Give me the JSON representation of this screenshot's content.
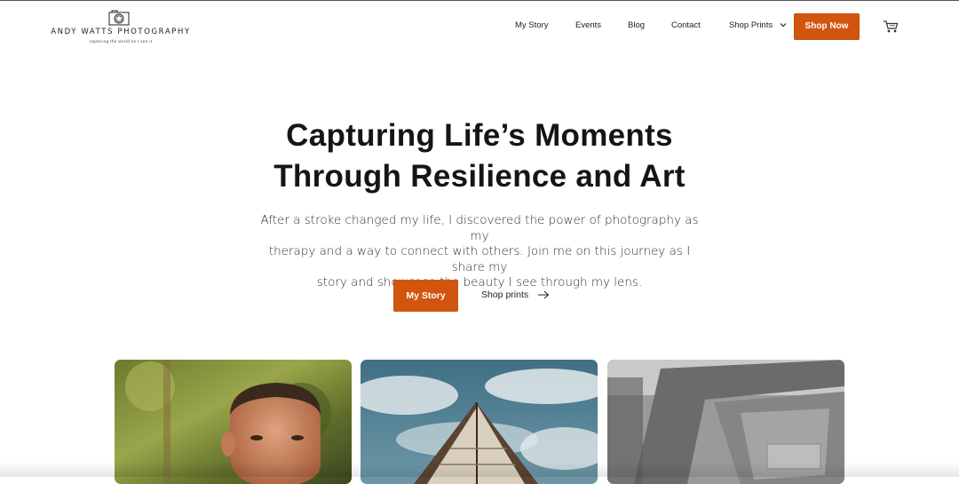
{
  "brand": {
    "name": "ANDY WATTS PHOTOGRAPHY",
    "tagline": "capturing the world as I see it",
    "logo_icon": "camera-icon"
  },
  "nav": {
    "items": [
      {
        "label": "My Story"
      },
      {
        "label": "Events"
      },
      {
        "label": "Blog"
      },
      {
        "label": "Contact"
      },
      {
        "label": "Shop Prints",
        "has_dropdown": true
      }
    ],
    "cta_label": "Shop Now",
    "cart_icon": "cart-icon"
  },
  "hero": {
    "title_line1": "Capturing Life’s Moments",
    "title_line2": "Through Resilience and Art",
    "body_line1": "After a stroke changed my life, I discovered the power of photography as my",
    "body_line2": "therapy and a way to connect with others. Join me on this journey as I share my",
    "body_line3": "story and showcase the beauty I see through my lens.",
    "primary_label": "My Story",
    "secondary_label": "Shop prints",
    "secondary_icon": "arrow-right-icon"
  },
  "gallery": {
    "images": [
      {
        "subject": "portrait photo"
      },
      {
        "subject": "boat and clouds photo"
      },
      {
        "subject": "architecture photo"
      }
    ]
  },
  "colors": {
    "accent": "#d1550e",
    "text": "#151515",
    "background": "#ffffff"
  }
}
